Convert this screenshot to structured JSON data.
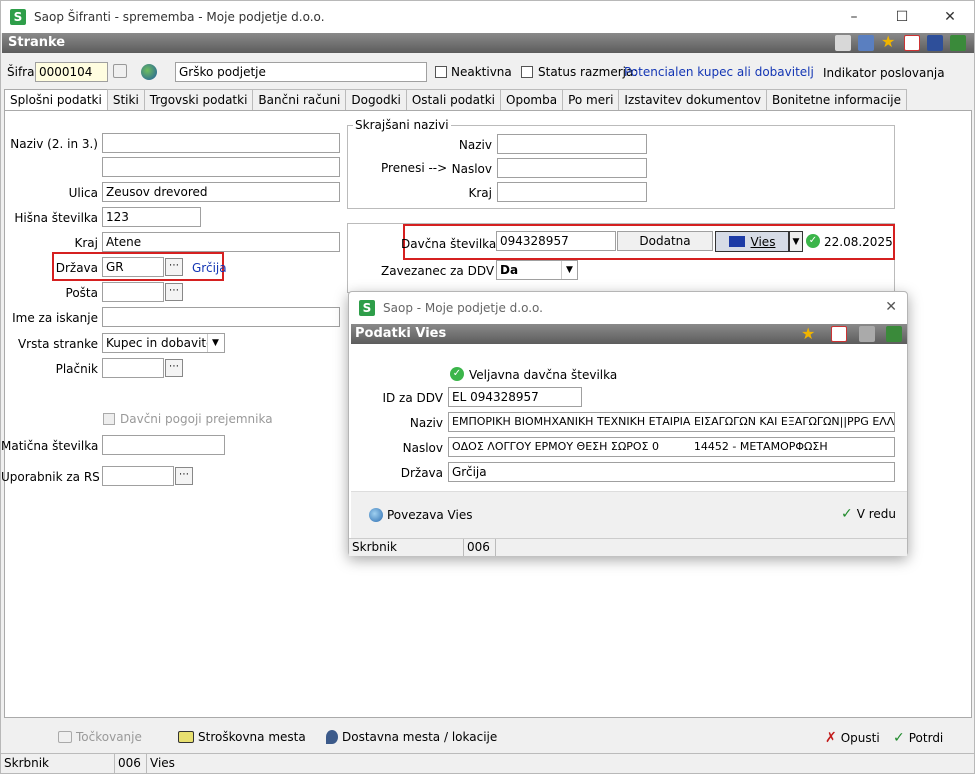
{
  "window": {
    "title": "Saop Šifranti - sprememba - Moje podjetje d.o.o."
  },
  "header": {
    "title": "Stranke"
  },
  "top": {
    "sifra_label": "Šifra",
    "sifra_value": "0000104",
    "name_value": "Grško podjetje",
    "neaktivna_label": "Neaktivna",
    "status_label": "Status razmerja:",
    "status_value": "Potencialen kupec ali dobavitelj",
    "indikator_label": "Indikator poslovanja"
  },
  "tabs": [
    "Splošni podatki",
    "Stiki",
    "Trgovski podatki",
    "Bančni računi",
    "Dogodki",
    "Ostali podatki",
    "Opomba",
    "Po meri",
    "Izstavitev dokumentov",
    "Bonitetne informacije"
  ],
  "left": {
    "naziv_label": "Naziv (2. in 3.)",
    "naziv2": "",
    "naziv3": "",
    "ulica_label": "Ulica",
    "ulica_value": "Zeusov drevored",
    "hisna_label": "Hišna številka",
    "hisna_value": "123",
    "kraj_label": "Kraj",
    "kraj_value": "Atene",
    "drzava_label": "Država",
    "drzava_value": "GR",
    "drzava_name": "Grčija",
    "posta_label": "Pošta",
    "ime_label": "Ime za iskanje",
    "vrsta_label": "Vrsta stranke",
    "vrsta_value": "Kupec in dobavitelj",
    "placnik_label": "Plačnik",
    "davcni_label": "Davčni pogoji prejemnika",
    "maticna_label": "Matična številka",
    "uporabnik_label": "Uporabnik za RS"
  },
  "right": {
    "skrajsani_label": "Skrajšani nazivi",
    "naziv_label": "Naziv",
    "prenesi_label": "Prenesi -->",
    "naslov_label": "Naslov",
    "kraj_label": "Kraj",
    "davcna_label": "Davčna številka",
    "davcna_value": "094328957",
    "dodatna_label": "Dodatna",
    "vies_label": "Vies",
    "vies_date": "22.08.2025",
    "zavezanec_label": "Zavezanec za DDV",
    "zavezanec_value": "Da"
  },
  "dialog": {
    "title": "Saop  - Moje podjetje d.o.o.",
    "header": "Podatki Vies",
    "valid_text": "Veljavna davčna številka",
    "id_label": "ID za DDV",
    "id_value": "EL 094328957",
    "naziv_label": "Naziv",
    "naziv_value": "ΕΜΠΟΡΙΚΗ ΒΙΟΜΗΧΑΝΙΚΗ ΤΕΧΝΙΚΗ ΕΤΑΙΡΙΑ ΕΙΣΑΓΩΓΩΝ ΚΑΙ ΕΞΑΓΩΓΩΝ||PPG ΕΛΛΑΣ ΑΕ",
    "naslov_label": "Naslov",
    "naslov_value": "ΟΔΟΣ ΛΟΓΓΟΥ ΕΡΜΟΥ ΘΕΣΗ ΣΩΡΟΣ 0          14452 - ΜΕΤΑΜΟΡΦΩΣΗ",
    "drzava_label": "Država",
    "drzava_value": "Grčija",
    "povezava_label": "Povezava Vies",
    "vredu_label": "V redu",
    "status_skrbnik": "Skrbnik",
    "status_code": "006"
  },
  "bottom": {
    "tockovanje": "Točkovanje",
    "stroskovna": "Stroškovna mesta",
    "dostavna": "Dostavna mesta / lokacije",
    "opusti": "Opusti",
    "potrdi": "Potrdi"
  },
  "statusbar": {
    "skrbnik": "Skrbnik",
    "code": "006",
    "extra": "Vies"
  },
  "colors": {
    "accent_red": "#d52020",
    "link_blue": "#1436b4",
    "header_gray": "#6b6b6b",
    "brand_green": "#2e9e49"
  }
}
